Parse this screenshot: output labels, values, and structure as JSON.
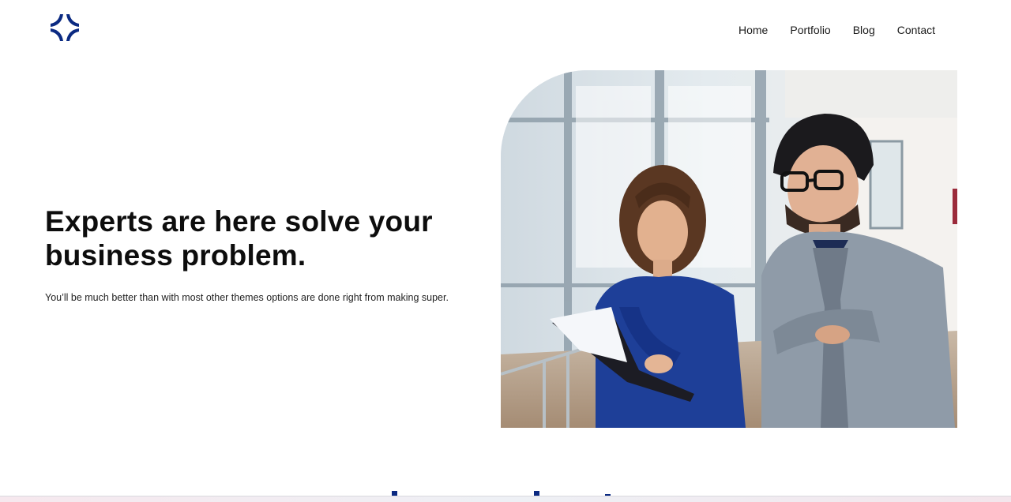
{
  "header": {
    "logo_icon": "four-arc-star-logo",
    "brand_color": "#0b2a82",
    "nav": [
      {
        "label": "Home"
      },
      {
        "label": "Portfolio"
      },
      {
        "label": "Blog"
      },
      {
        "label": "Contact"
      }
    ]
  },
  "hero": {
    "title": "Experts are here solve your business problem.",
    "subtitle": "You’ll be much better than with most other themes options are done right from making super.",
    "image": "photo-two-business-colleagues-reviewing-document-in-office"
  }
}
